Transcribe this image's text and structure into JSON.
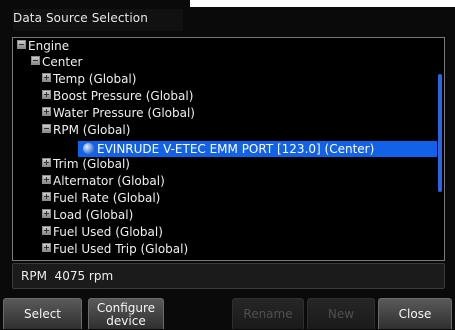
{
  "window": {
    "title": "Data Source Selection"
  },
  "tree": {
    "items": [
      {
        "label": "Engine",
        "state": "minus"
      },
      {
        "label": "Center",
        "state": "minus"
      },
      {
        "label": "Temp (Global)",
        "state": "plus"
      },
      {
        "label": "Boost Pressure (Global)",
        "state": "plus"
      },
      {
        "label": "Water Pressure (Global)",
        "state": "plus"
      },
      {
        "label": "RPM (Global)",
        "state": "minus"
      },
      {
        "label": "EVINRUDE V-ETEC EMM PORT [123.0] (Center)",
        "state": "source",
        "selected": true
      },
      {
        "label": "Trim (Global)",
        "state": "plus"
      },
      {
        "label": "Alternator (Global)",
        "state": "plus"
      },
      {
        "label": "Fuel Rate (Global)",
        "state": "plus"
      },
      {
        "label": "Load (Global)",
        "state": "plus"
      },
      {
        "label": "Fuel Used (Global)",
        "state": "plus"
      },
      {
        "label": "Fuel Used Trip (Global)",
        "state": "plus"
      }
    ]
  },
  "status": {
    "text": "RPM  4075 rpm"
  },
  "buttons": {
    "select": "Select",
    "configure_line1": "Configure",
    "configure_line2": "device",
    "rename": "Rename",
    "new": "New",
    "close": "Close"
  },
  "icons": {
    "expanded": "minus-box-icon",
    "collapsed": "plus-box-icon",
    "source": "data-source-ball-icon"
  },
  "colors": {
    "selection": "#1262e8",
    "scrollbar": "#2d64e6",
    "background": "#000000"
  }
}
